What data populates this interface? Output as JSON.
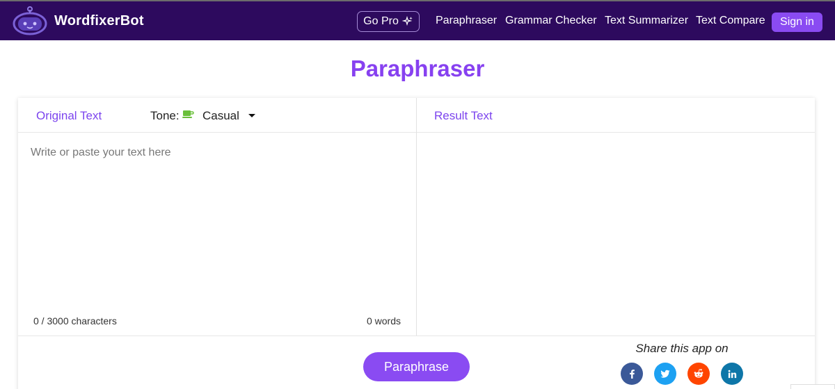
{
  "header": {
    "brand": "WordfixerBot",
    "go_pro": "Go Pro",
    "nav": [
      "Paraphraser",
      "Grammar Checker",
      "Text Summarizer",
      "Text Compare"
    ],
    "sign_in": "Sign in"
  },
  "page_title": "Paraphraser",
  "editor": {
    "original_label": "Original Text",
    "tone_label": "Tone:",
    "tone_value": "Casual",
    "tone_icon": "coffee-cup-icon",
    "result_label": "Result Text",
    "placeholder": "Write or paste your text here",
    "char_count": "0 / 3000 characters",
    "word_count": "0 words"
  },
  "actions": {
    "paraphrase_button": "Paraphrase"
  },
  "share": {
    "title": "Share this app on",
    "icons": [
      "facebook-icon",
      "twitter-icon",
      "reddit-icon",
      "linkedin-icon"
    ]
  },
  "colors": {
    "nav_bg": "#2d0a5e",
    "accent": "#8a4bf2",
    "title": "#8741f0"
  }
}
